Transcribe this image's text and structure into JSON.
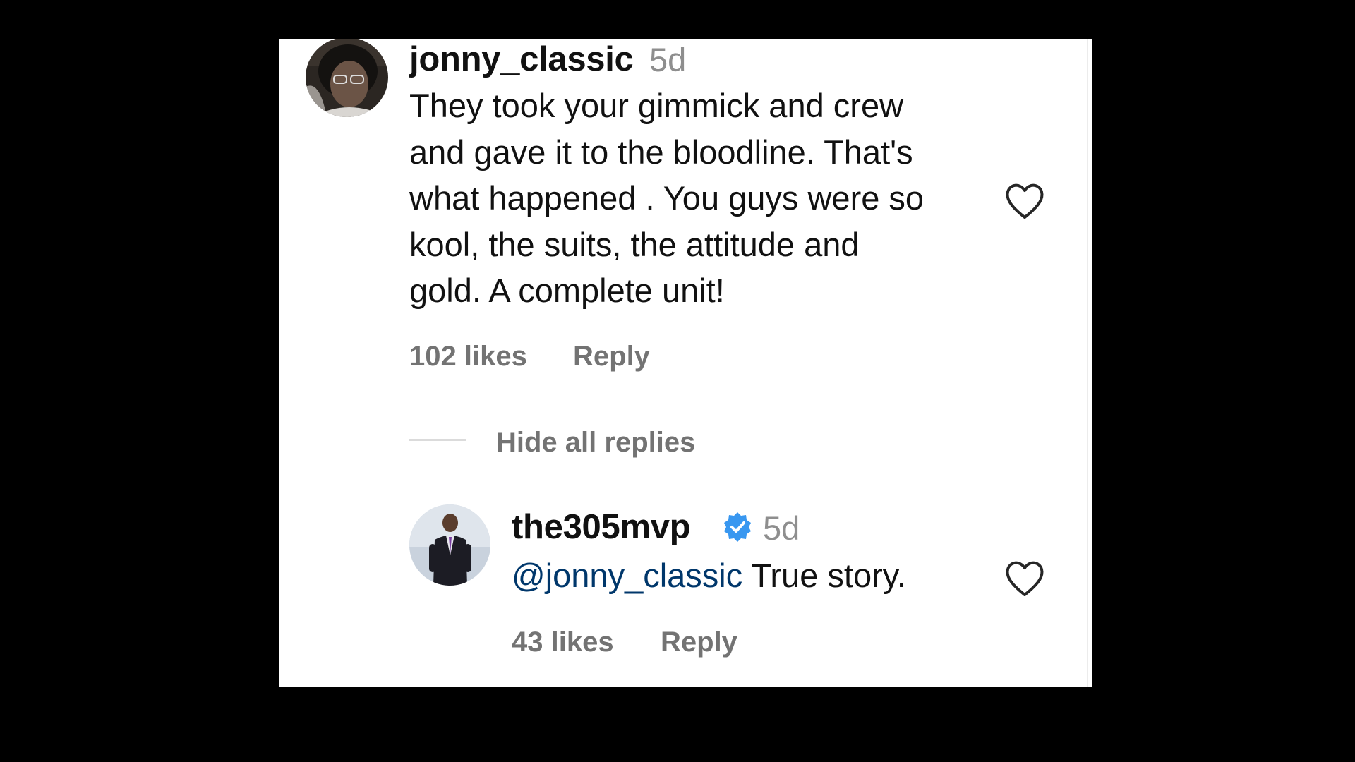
{
  "comment": {
    "username": "jonny_classic",
    "time": "5d",
    "text_lines": [
      "They took your gimmick and crew",
      "and gave it to the bloodline. That's",
      "what happened . You guys were so",
      "kool, the suits, the attitude and",
      "gold. A complete unit!"
    ],
    "likes": "102 likes",
    "reply_label": "Reply",
    "like_icon": "heart-outline-icon"
  },
  "replies_toggle": {
    "label": "Hide all replies"
  },
  "reply": {
    "username": "the305mvp",
    "verified": true,
    "verified_icon": "verified-badge-icon",
    "verified_color": "#3897f0",
    "time": "5d",
    "mention": "@jonny_classic",
    "text": " True story.",
    "likes": "43 likes",
    "reply_label": "Reply",
    "like_icon": "heart-outline-icon"
  }
}
